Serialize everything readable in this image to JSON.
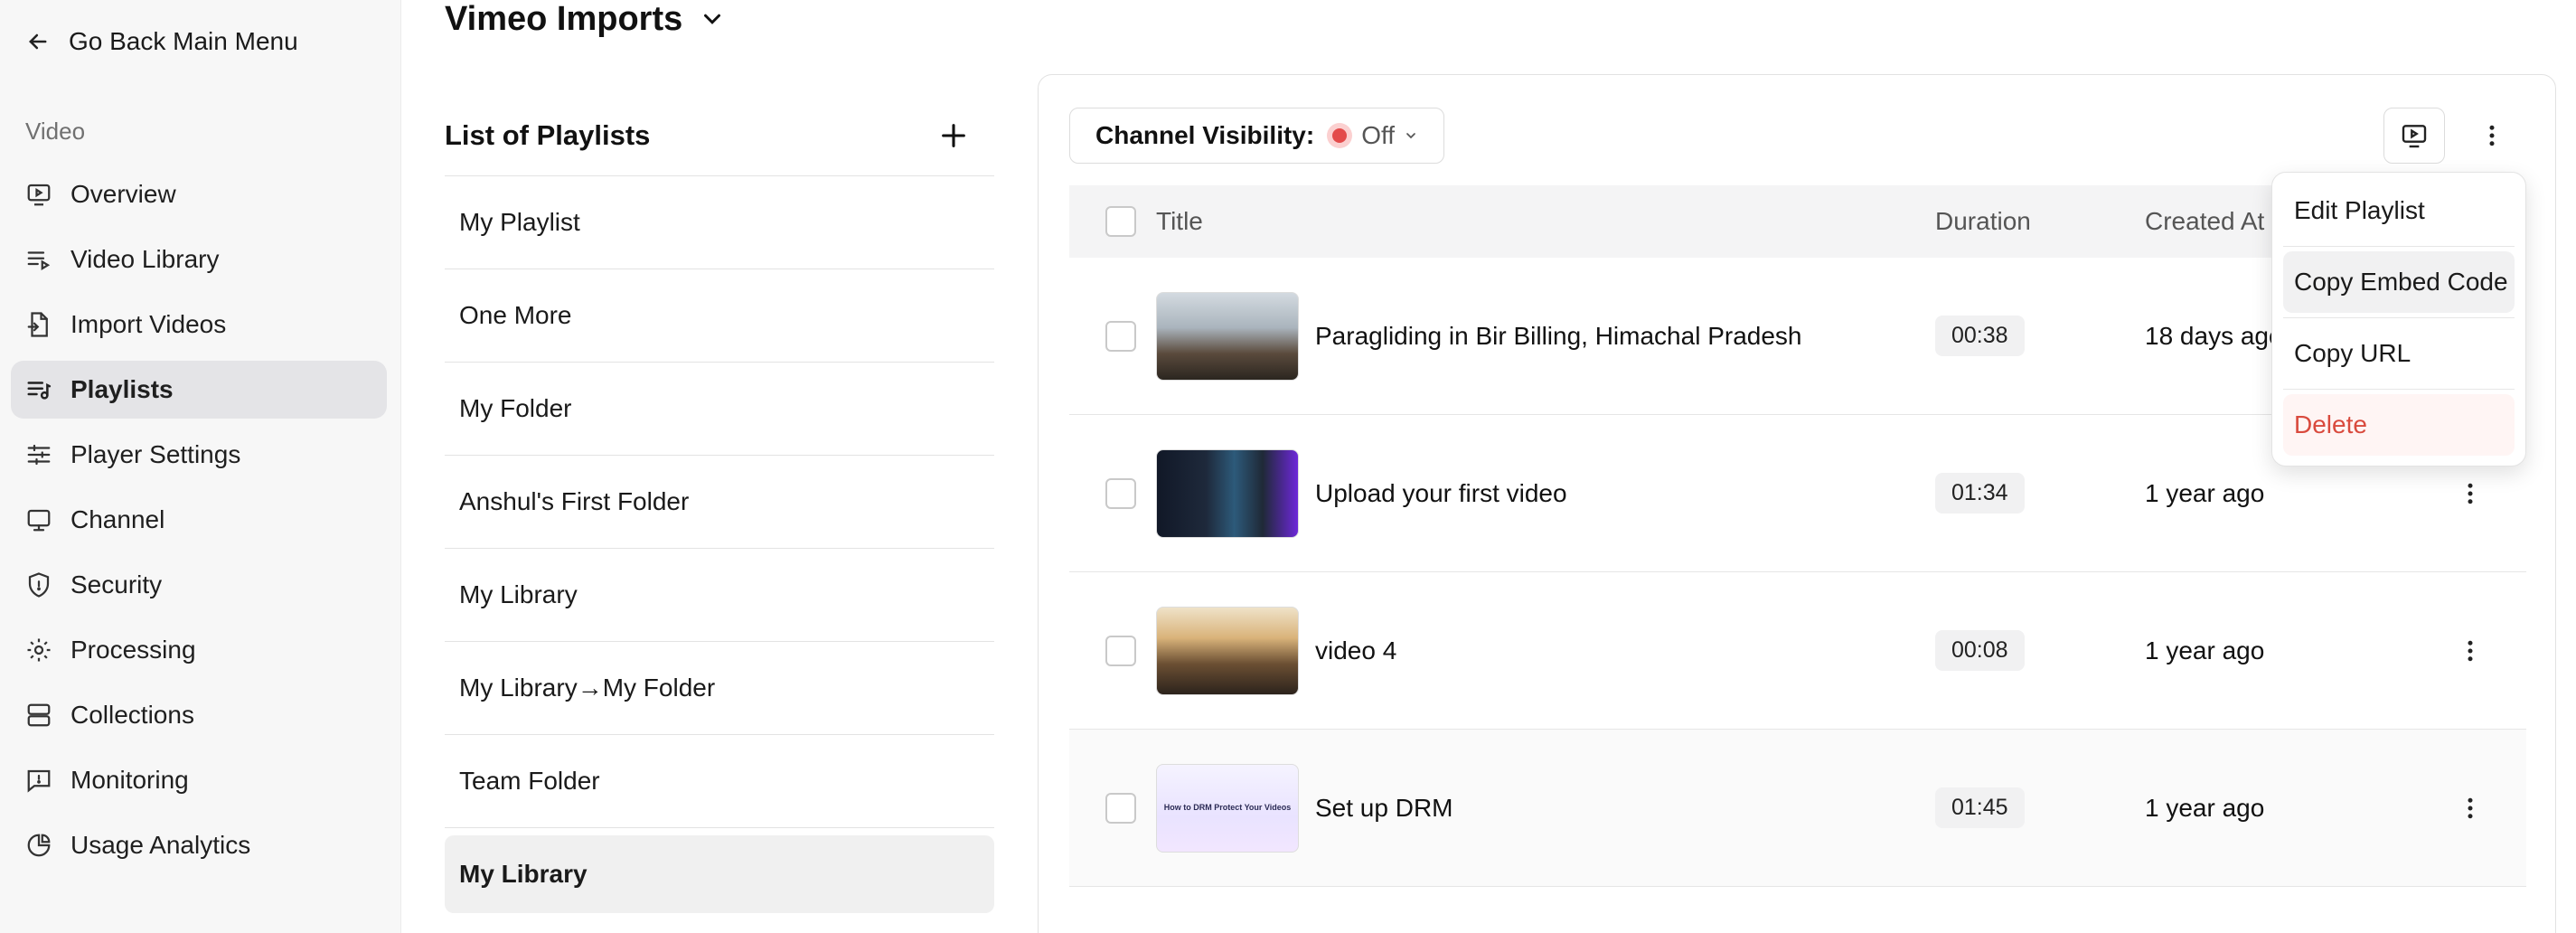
{
  "sidebar": {
    "back_label": "Go Back Main Menu",
    "section_label": "Video",
    "items": [
      {
        "label": "Overview",
        "icon": "play-screen-icon"
      },
      {
        "label": "Video Library",
        "icon": "list-play-icon"
      },
      {
        "label": "Import Videos",
        "icon": "file-import-icon"
      },
      {
        "label": "Playlists",
        "icon": "playlist-icon",
        "active": true
      },
      {
        "label": "Player Settings",
        "icon": "sliders-icon"
      },
      {
        "label": "Channel",
        "icon": "monitor-icon"
      },
      {
        "label": "Security",
        "icon": "shield-icon"
      },
      {
        "label": "Processing",
        "icon": "gear-icon"
      },
      {
        "label": "Collections",
        "icon": "server-stack-icon"
      },
      {
        "label": "Monitoring",
        "icon": "message-square-icon"
      },
      {
        "label": "Usage Analytics",
        "icon": "pie-chart-icon"
      }
    ]
  },
  "header": {
    "title": "Vimeo Imports"
  },
  "playlists": {
    "title": "List of Playlists",
    "items": [
      "My Playlist",
      "One More",
      "My Folder",
      "Anshul's First Folder",
      "My Library",
      "My Library→My Folder",
      "Team Folder",
      "My Library"
    ],
    "active_index": 7
  },
  "toolbar": {
    "visibility_label": "Channel Visibility:",
    "visibility_value": "Off"
  },
  "table": {
    "headers": {
      "title": "Title",
      "duration": "Duration",
      "created": "Created At"
    },
    "rows": [
      {
        "title": "Paragliding in Bir Billing, Himachal Pradesh",
        "duration": "00:38",
        "created": "18 days ago"
      },
      {
        "title": "Upload your first video",
        "duration": "01:34",
        "created": "1 year ago"
      },
      {
        "title": "video 4",
        "duration": "00:08",
        "created": "1 year ago"
      },
      {
        "title": "Set up DRM",
        "duration": "01:45",
        "created": "1 year ago",
        "thumb_text": "How to DRM Protect Your Videos"
      }
    ]
  },
  "menu": {
    "edit": "Edit Playlist",
    "embed": "Copy Embed Code",
    "url": "Copy URL",
    "delete": "Delete"
  },
  "colors": {
    "danger": "#d94a3d",
    "active_bg": "#e4e4e7",
    "status_off": "#e34b4b"
  }
}
